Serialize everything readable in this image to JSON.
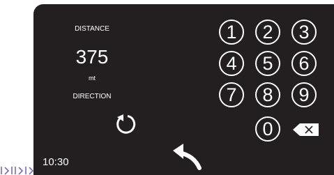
{
  "trip": {
    "distance_label": "DISTANCE",
    "distance_value": "375",
    "distance_unit": "mt",
    "direction_label": "DIRECTION"
  },
  "keypad": {
    "keys": [
      "1",
      "2",
      "3",
      "4",
      "5",
      "6",
      "7",
      "8",
      "9",
      "0"
    ]
  },
  "status": {
    "time": "10:30"
  },
  "icons": {
    "direction": "refresh-icon",
    "delete": "backspace-icon",
    "back": "back-arrow-icon"
  },
  "colors": {
    "panel": "#231f20",
    "foreground": "#ffffff",
    "edge_marks": "#6a5fc6"
  }
}
